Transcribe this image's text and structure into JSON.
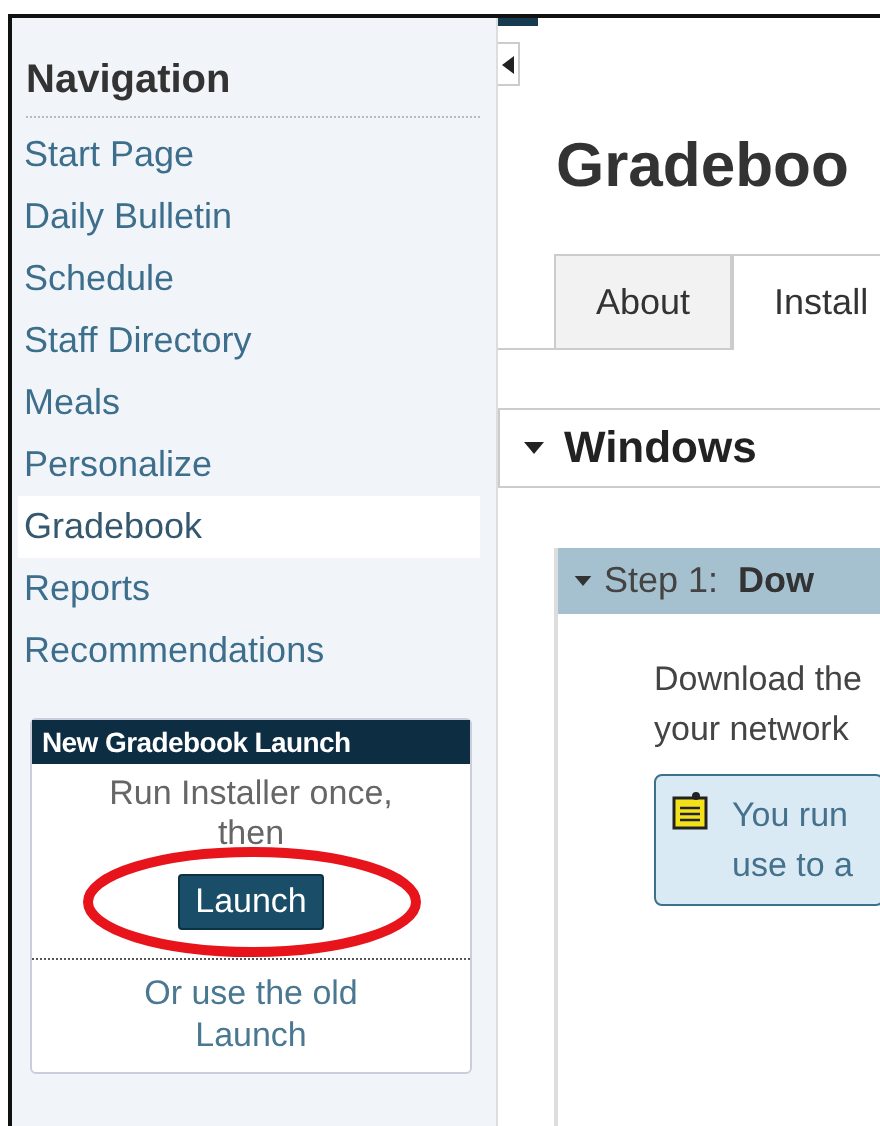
{
  "sidebar": {
    "heading": "Navigation",
    "items": [
      {
        "label": "Start Page",
        "selected": false
      },
      {
        "label": "Daily Bulletin",
        "selected": false
      },
      {
        "label": "Schedule",
        "selected": false
      },
      {
        "label": "Staff Directory",
        "selected": false
      },
      {
        "label": "Meals",
        "selected": false
      },
      {
        "label": "Personalize",
        "selected": false
      },
      {
        "label": "Gradebook",
        "selected": true
      },
      {
        "label": "Reports",
        "selected": false
      },
      {
        "label": "Recommendations",
        "selected": false
      }
    ],
    "launch_box": {
      "title": "New Gradebook Launch",
      "text": "Run Installer once, then",
      "button": "Launch",
      "old_link": "Or use the old Launch"
    }
  },
  "page": {
    "title": "Gradeboo",
    "tabs": [
      {
        "label": "About",
        "selected": false
      },
      {
        "label": "Install",
        "selected": true
      }
    ],
    "section": {
      "title": "Windows",
      "expanded": true,
      "step": {
        "label": "Step 1:",
        "title": "Dow",
        "expanded": true,
        "lines": [
          "Download the",
          "your network"
        ],
        "note": [
          "You run",
          "use to a"
        ]
      }
    }
  }
}
